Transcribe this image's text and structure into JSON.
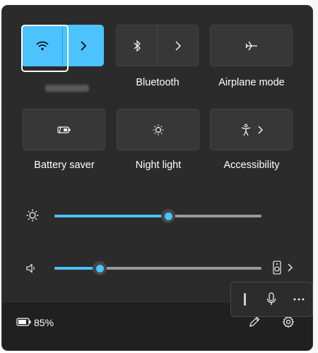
{
  "quick_settings": {
    "tiles": [
      {
        "id": "wifi",
        "label": "",
        "state": "on",
        "icon": "wifi-icon"
      },
      {
        "id": "bluetooth",
        "label": "Bluetooth",
        "state": "off",
        "icon": "bluetooth-icon"
      },
      {
        "id": "airplane",
        "label": "Airplane mode",
        "state": "off",
        "icon": "airplane-icon"
      },
      {
        "id": "battery_saver",
        "label": "Battery saver",
        "state": "off",
        "icon": "battery-saver-icon"
      },
      {
        "id": "night_light",
        "label": "Night light",
        "state": "off",
        "icon": "night-light-icon"
      },
      {
        "id": "accessibility",
        "label": "Accessibility",
        "state": "off",
        "icon": "accessibility-icon"
      }
    ],
    "brightness": {
      "icon": "brightness-icon",
      "level": 0.55
    },
    "volume": {
      "icon": "speaker-icon",
      "level": 0.22,
      "output_icon": "speaker-device-icon"
    },
    "popup": {
      "items": [
        "grip-icon",
        "microphone-icon",
        "more-icon"
      ]
    },
    "footer": {
      "battery_text": "85%",
      "battery_icon": "battery-icon",
      "edit_icon": "pencil-icon",
      "settings_icon": "gear-icon"
    },
    "colors": {
      "accent": "#4cc2ff",
      "panel": "#2b2b2b",
      "tile": "#373737"
    }
  }
}
